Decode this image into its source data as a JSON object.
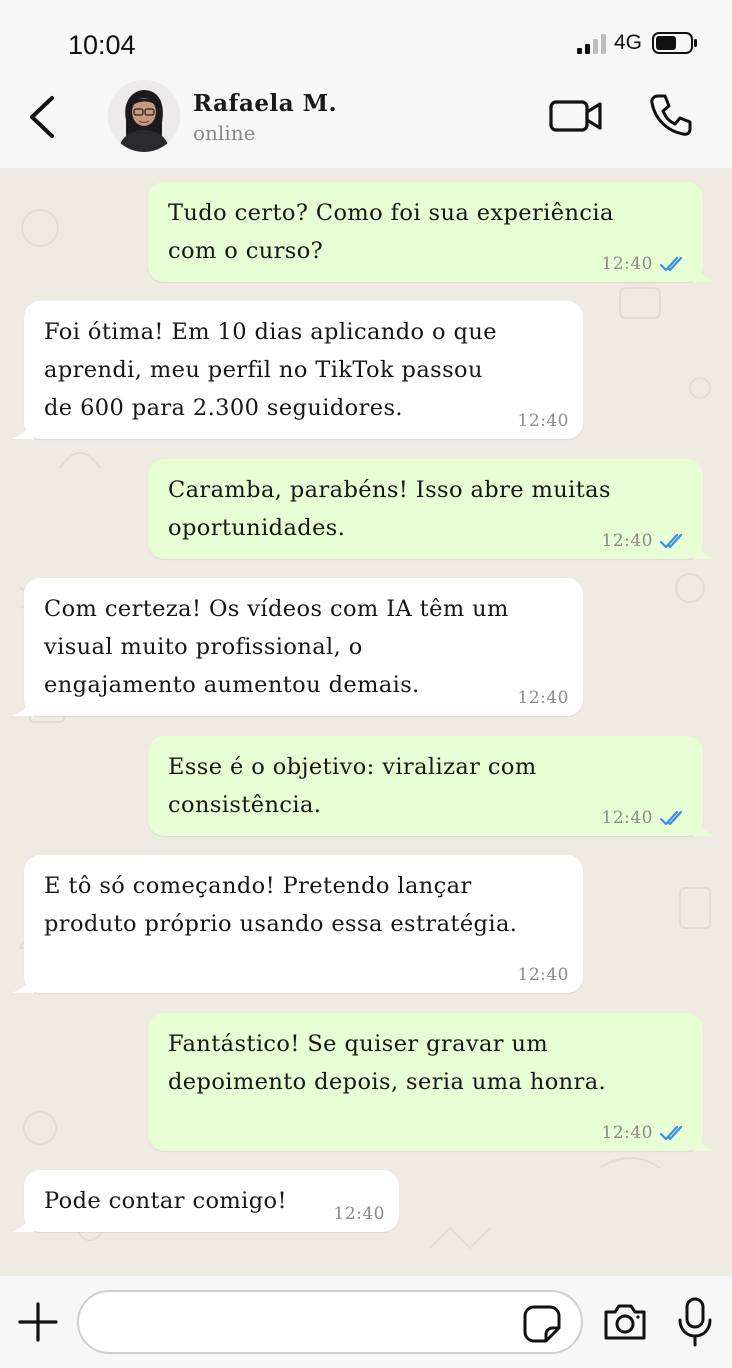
{
  "status_bar": {
    "time": "10:04",
    "network": "4G"
  },
  "header": {
    "contact_name": "Rafaela M.",
    "contact_status": "online"
  },
  "messages": [
    {
      "direction": "out",
      "text": "Tudo certo? Como foi sua experiência\ncom o curso?",
      "time": "12:40",
      "read": true
    },
    {
      "direction": "in",
      "text": "Foi ótima! Em 10 dias aplicando o que\naprendi, meu perfil no TikTok passou\nde 600 para 2.300 seguidores.",
      "time": "12:40"
    },
    {
      "direction": "out",
      "text": "Caramba, parabéns! Isso abre muitas\noportunidades.",
      "time": "12:40",
      "read": true
    },
    {
      "direction": "in",
      "text": "Com certeza! Os vídeos com IA têm um\nvisual muito profissional, o\nengajamento aumentou demais.",
      "time": "12:40"
    },
    {
      "direction": "out",
      "text": "Esse é o objetivo: viralizar com\nconsistência.",
      "time": "12:40",
      "read": true
    },
    {
      "direction": "in",
      "text": "E tô só começando! Pretendo lançar\nproduto próprio usando essa estratégia.",
      "time": "12:40"
    },
    {
      "direction": "out",
      "text": "Fantástico! Se quiser gravar um\ndepoimento depois, seria uma honra.",
      "time": "12:40",
      "read": true
    },
    {
      "direction": "in",
      "text": "Pode contar comigo!",
      "time": "12:40"
    }
  ],
  "input": {
    "value": "",
    "placeholder": ""
  },
  "colors": {
    "outgoing_bubble": "#e7fdd3",
    "incoming_bubble": "#ffffff",
    "read_ticks": "#3b8ee8",
    "chat_background": "#efeae2"
  },
  "icons": [
    "back-icon",
    "video-call-icon",
    "voice-call-icon",
    "plus-icon",
    "sticker-icon",
    "camera-icon",
    "microphone-icon",
    "double-check-icon"
  ]
}
